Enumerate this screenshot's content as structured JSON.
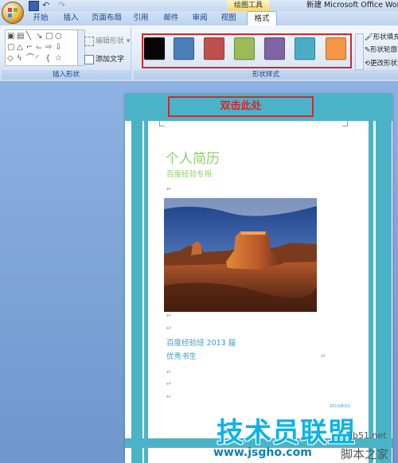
{
  "window": {
    "title": "新建 Microsoft Office Word",
    "context_tab": "绘图工具"
  },
  "tabs": [
    {
      "label": "开始"
    },
    {
      "label": "插入"
    },
    {
      "label": "页面布局"
    },
    {
      "label": "引用"
    },
    {
      "label": "邮件"
    },
    {
      "label": "审阅"
    },
    {
      "label": "视图"
    },
    {
      "label": "格式",
      "active": true
    }
  ],
  "ribbon": {
    "insert_shapes": {
      "group_label": "插入形状",
      "edit_shape_label": "编辑形状",
      "add_text_label": "添加文字"
    },
    "shape_styles": {
      "group_label": "形状样式",
      "swatches": [
        {
          "color": "#050505"
        },
        {
          "color": "#4a7ebb"
        },
        {
          "color": "#c0504d"
        },
        {
          "color": "#9bbb59"
        },
        {
          "color": "#8064a2"
        },
        {
          "color": "#4bacc6"
        },
        {
          "color": "#f79646"
        }
      ],
      "fill_label": "形状填充",
      "outline_label": "形状轮廓",
      "change_label": "更改形状"
    }
  },
  "document": {
    "header_callout": "双击此处",
    "title": "个人简历",
    "subtitle": "百度经验专用",
    "class_line": "百度经验班 2013 届",
    "student_line": "优秀书生",
    "date": "2013/8/22"
  },
  "watermark": {
    "main": "技术员联盟",
    "url": "www.jsgho.com",
    "side_top": "jb51.net",
    "side_bottom": "脚本之家"
  },
  "colors": {
    "accent_teal": "#4bb3c8",
    "highlight_red": "#d3272f",
    "title_green": "#8ccf6c",
    "body_blue": "#3b99c8"
  }
}
